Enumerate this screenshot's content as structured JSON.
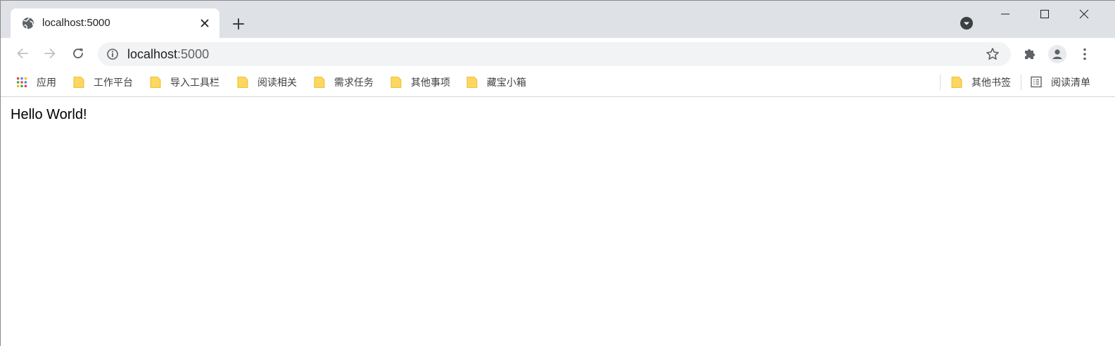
{
  "tab": {
    "title": "localhost:5000",
    "favicon_icon": "globe-icon"
  },
  "window_controls": [
    "minimize-icon",
    "maximize-icon",
    "close-icon"
  ],
  "toolbar": {
    "back_icon": "arrow-left-icon",
    "forward_icon": "arrow-right-icon",
    "reload_icon": "reload-icon",
    "extensions_icon": "puzzle-icon",
    "profile_icon": "person-icon",
    "menu_icon": "kebab-menu-icon"
  },
  "omnibox": {
    "host": "localhost",
    "port": ":5000",
    "info_icon": "info-icon",
    "bookmark_icon": "star-icon"
  },
  "bookmarks": {
    "apps_label": "应用",
    "items": [
      {
        "label": "工作平台"
      },
      {
        "label": "导入工具栏"
      },
      {
        "label": "阅读相关"
      },
      {
        "label": "需求任务"
      },
      {
        "label": "其他事项"
      },
      {
        "label": "藏宝小箱"
      }
    ],
    "other_label": "其他书签",
    "reading_list_label": "阅读清单"
  },
  "colors": {
    "tabstrip": "#dee1e6",
    "omnibox": "#f1f3f4",
    "folder": "#fdd663",
    "icon_gray": "#5f6368"
  },
  "page": {
    "text": "Hello World!"
  }
}
